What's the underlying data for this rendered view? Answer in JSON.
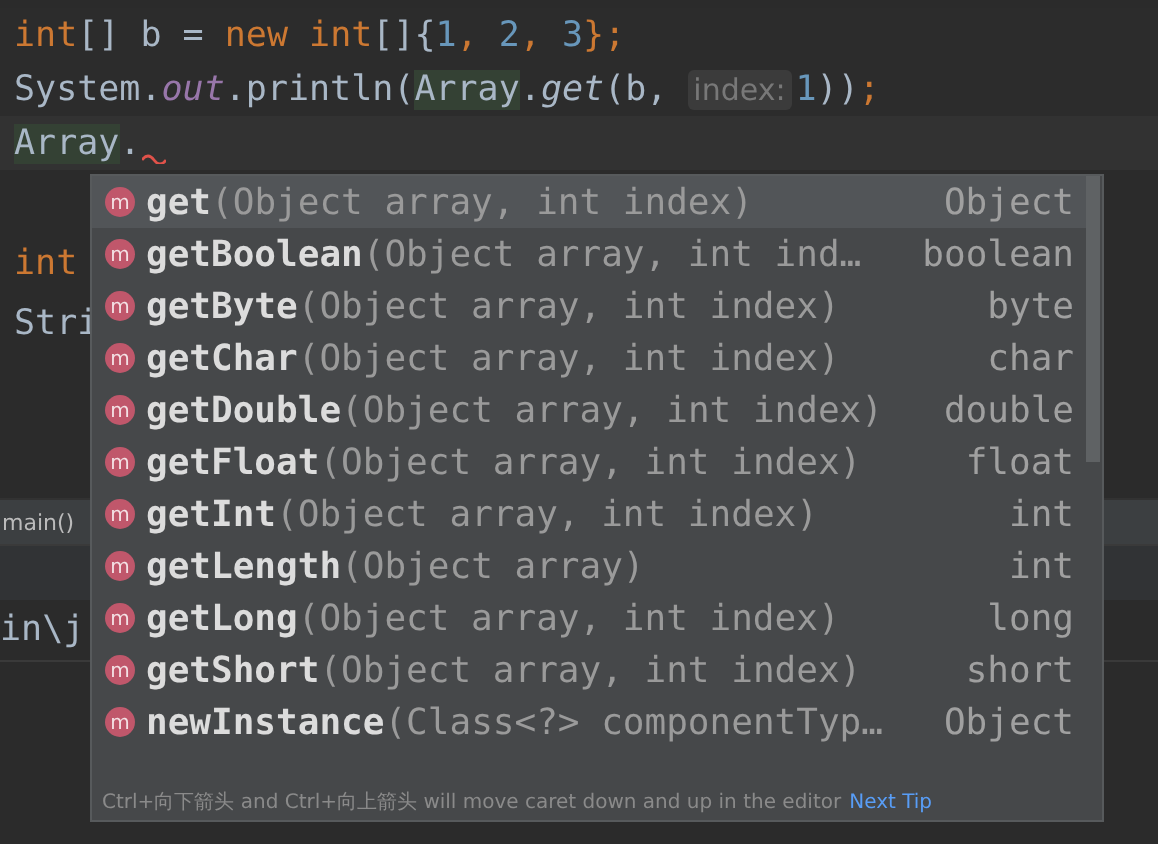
{
  "editor": {
    "lines": [
      {
        "current": false,
        "tokens": [
          {
            "text": "int",
            "kind": "keyword"
          },
          {
            "text": "[] b = ",
            "kind": "plain"
          },
          {
            "text": "new ",
            "kind": "keyword"
          },
          {
            "text": "int",
            "kind": "keyword"
          },
          {
            "text": "[]{",
            "kind": "plain"
          },
          {
            "text": "1",
            "kind": "number"
          },
          {
            "text": ", ",
            "kind": "punct"
          },
          {
            "text": "2",
            "kind": "number"
          },
          {
            "text": ", ",
            "kind": "punct"
          },
          {
            "text": "3",
            "kind": "number"
          },
          {
            "text": "};",
            "kind": "punct"
          }
        ]
      },
      {
        "current": false,
        "tokens": [
          {
            "text": "System.",
            "kind": "plain"
          },
          {
            "text": "out",
            "kind": "field"
          },
          {
            "text": ".println(",
            "kind": "plain"
          },
          {
            "text": "Array",
            "kind": "highlight"
          },
          {
            "text": ".",
            "kind": "plain"
          },
          {
            "text": "get",
            "kind": "method"
          },
          {
            "text": "(b,",
            "kind": "plain"
          },
          {
            "text": "index:",
            "kind": "hint"
          },
          {
            "text": "1",
            "kind": "number"
          },
          {
            "text": "))",
            "kind": "plain"
          },
          {
            "text": ";",
            "kind": "punct"
          }
        ]
      },
      {
        "current": true,
        "tokens": [
          {
            "text": "Array",
            "kind": "highlight"
          },
          {
            "text": ".",
            "kind": "plain"
          }
        ]
      }
    ],
    "behind": [
      {
        "tokens": [
          {
            "text": "int",
            "kind": "keyword"
          }
        ]
      },
      {
        "tokens": [
          {
            "text": "Stri",
            "kind": "plain"
          }
        ]
      }
    ],
    "breadcrumb": "main()",
    "console_line": "in\\j"
  },
  "completion": {
    "items": [
      {
        "icon": "m",
        "name": "get",
        "params": "(Object array, int index)",
        "type": "Object",
        "selected": true
      },
      {
        "icon": "m",
        "name": "getBoolean",
        "params": "(Object array, int ind…",
        "type": "boolean",
        "selected": false
      },
      {
        "icon": "m",
        "name": "getByte",
        "params": "(Object array, int index)",
        "type": "byte",
        "selected": false
      },
      {
        "icon": "m",
        "name": "getChar",
        "params": "(Object array, int index)",
        "type": "char",
        "selected": false
      },
      {
        "icon": "m",
        "name": "getDouble",
        "params": "(Object array, int index)",
        "type": "double",
        "selected": false
      },
      {
        "icon": "m",
        "name": "getFloat",
        "params": "(Object array, int index)",
        "type": "float",
        "selected": false
      },
      {
        "icon": "m",
        "name": "getInt",
        "params": "(Object array, int index)",
        "type": "int",
        "selected": false
      },
      {
        "icon": "m",
        "name": "getLength",
        "params": "(Object array)",
        "type": "int",
        "selected": false
      },
      {
        "icon": "m",
        "name": "getLong",
        "params": "(Object array, int index)",
        "type": "long",
        "selected": false
      },
      {
        "icon": "m",
        "name": "getShort",
        "params": "(Object array, int index)",
        "type": "short",
        "selected": false
      },
      {
        "icon": "m",
        "name": "newInstance",
        "params": "(Class<?> componentTyp…",
        "type": "Object",
        "selected": false
      }
    ],
    "footer": "Ctrl+向下箭头 and Ctrl+向上箭头 will move caret down and up in the editor",
    "footer_link": "Next Tip"
  }
}
